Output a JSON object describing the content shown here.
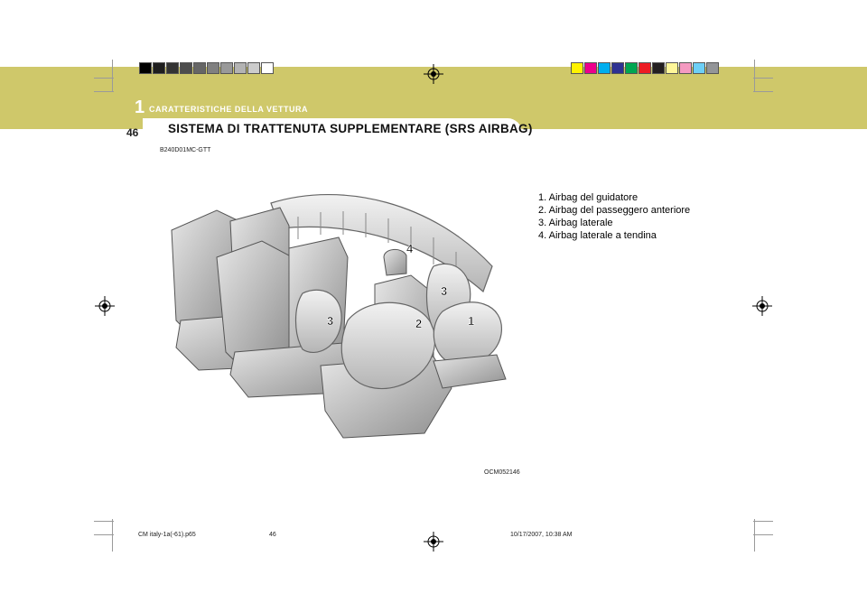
{
  "header": {
    "chapter_number": "1",
    "chapter_title": "CARATTERISTICHE DELLA VETTURA",
    "page_number": "46",
    "section_title": "SISTEMA DI TRATTENUTA SUPPLEMENTARE (SRS AIRBAG)"
  },
  "document_code": "B240D01MC-GTT",
  "legend": [
    "1. Airbag del guidatore",
    "2. Airbag del passeggero anteriore",
    "3. Airbag laterale",
    "4. Airbag laterale a tendina"
  ],
  "figure": {
    "labels": [
      "1",
      "2",
      "3",
      "3",
      "4"
    ],
    "code": "OCM052146"
  },
  "footer": {
    "file": "CM italy-1a(-61).p65",
    "page": "46",
    "timestamp": "10/17/2007, 10:38 AM"
  },
  "colors": {
    "header_band": "#cfc86a",
    "gray_swatches": [
      "#000000",
      "#1e1e1e",
      "#333333",
      "#4d4d4d",
      "#666666",
      "#808080",
      "#999999",
      "#b3b3b3",
      "#cccccc",
      "#ffffff"
    ],
    "color_swatches": [
      "#fff200",
      "#ec008c",
      "#00aeef",
      "#2e3192",
      "#00a651",
      "#ed1c24",
      "#231f20",
      "#fff799",
      "#f49ac1",
      "#6dcff6",
      "#939598"
    ]
  }
}
